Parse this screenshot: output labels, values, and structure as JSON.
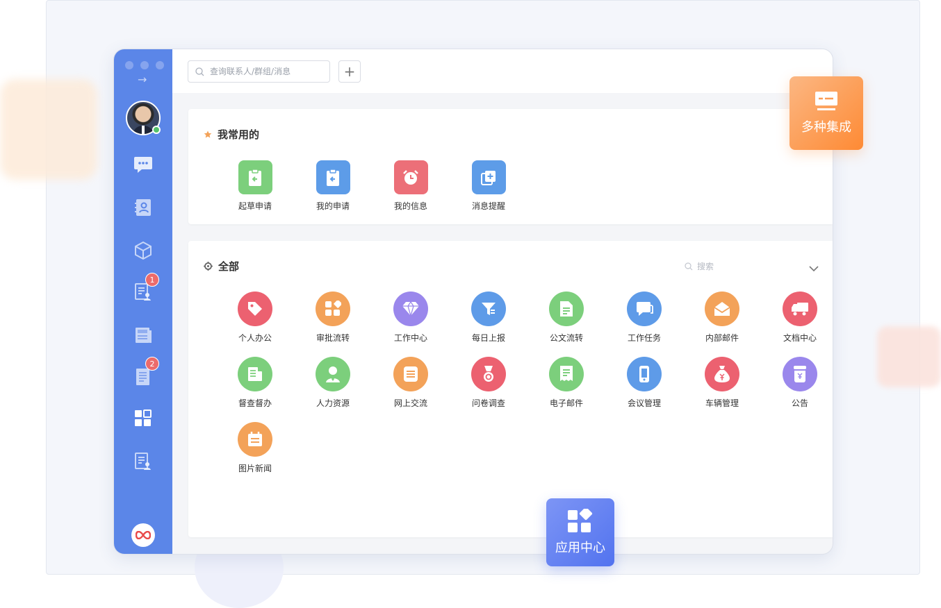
{
  "search": {
    "placeholder": "查询联系人/群组/消息"
  },
  "toolbar": {
    "add_label": "+"
  },
  "sidebar": {
    "arrow": "→",
    "badges": [
      "1",
      "2"
    ],
    "icons": [
      "chat-icon",
      "contacts-icon",
      "cube-icon",
      "doc-user-icon",
      "news-icon",
      "doc-list-icon",
      "apps-grid-icon",
      "doc-person-icon",
      "brand-logo-icon"
    ]
  },
  "favorites": {
    "title": "我常用的",
    "items": [
      {
        "label": "起草申请",
        "color": "#7ccf7c",
        "icon": "clipboard-icon"
      },
      {
        "label": "我的申请",
        "color": "#5d9ce8",
        "icon": "clipboard-icon"
      },
      {
        "label": "我的信息",
        "color": "#ec6f78",
        "icon": "alarm-icon"
      },
      {
        "label": "消息提醒",
        "color": "#5d9ce8",
        "icon": "add-copy-icon"
      }
    ]
  },
  "all_apps": {
    "title": "全部",
    "search_placeholder": "搜索",
    "items": [
      {
        "label": "个人办公",
        "color": "#ec6170",
        "icon": "tag-icon"
      },
      {
        "label": "审批流转",
        "color": "#f3a259",
        "icon": "blocks-icon"
      },
      {
        "label": "工作中心",
        "color": "#9a87ec",
        "icon": "diamond-icon"
      },
      {
        "label": "每日上报",
        "color": "#5e9be8",
        "icon": "filter-icon"
      },
      {
        "label": "公文流转",
        "color": "#7ccf7c",
        "icon": "file-icon"
      },
      {
        "label": "工作任务",
        "color": "#5e9be8",
        "icon": "message-icon"
      },
      {
        "label": "内部邮件",
        "color": "#f3a259",
        "icon": "envelope-icon"
      },
      {
        "label": "文档中心",
        "color": "#ec6170",
        "icon": "truck-icon"
      },
      {
        "label": "督查督办",
        "color": "#7ccf7c",
        "icon": "doc-icon"
      },
      {
        "label": "人力资源",
        "color": "#7ccf7c",
        "icon": "person-icon"
      },
      {
        "label": "网上交流",
        "color": "#f3a259",
        "icon": "list-icon"
      },
      {
        "label": "问卷调查",
        "color": "#ec6170",
        "icon": "medal-icon"
      },
      {
        "label": "电子邮件",
        "color": "#7ccf7c",
        "icon": "receipt-icon"
      },
      {
        "label": "会议管理",
        "color": "#5e9be8",
        "icon": "phone-icon"
      },
      {
        "label": "车辆管理",
        "color": "#ec6170",
        "icon": "money-bag-icon"
      },
      {
        "label": "公告",
        "color": "#9a87ec",
        "icon": "jar-icon"
      },
      {
        "label": "图片新闻",
        "color": "#f3a259",
        "icon": "calendar-icon"
      }
    ]
  },
  "feature_badges": {
    "multi": "多种集成",
    "app_center": "应用中心"
  }
}
